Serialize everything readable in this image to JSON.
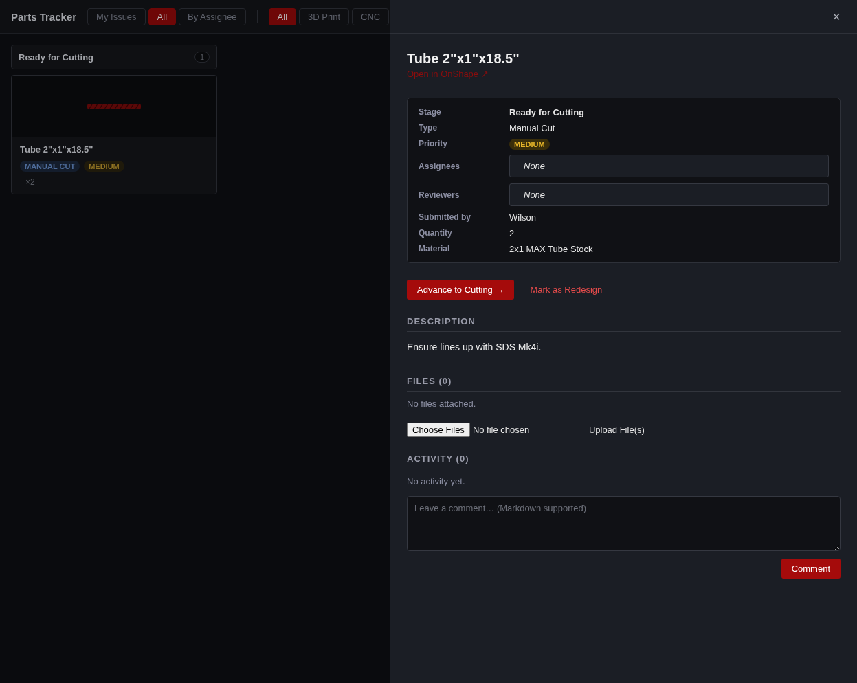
{
  "app": {
    "title": "Parts Tracker"
  },
  "scope_tabs": [
    {
      "label": "My Issues",
      "selected": false
    },
    {
      "label": "All",
      "selected": true
    },
    {
      "label": "By Assignee",
      "selected": false
    }
  ],
  "type_tabs": [
    {
      "label": "All",
      "selected": true
    },
    {
      "label": "3D Print",
      "selected": false
    },
    {
      "label": "CNC",
      "selected": false
    }
  ],
  "column": {
    "title": "Ready for Cutting",
    "count": "1",
    "cards": [
      {
        "title": "Tube 2\"x1\"x18.5\"",
        "tags": [
          {
            "label": "MANUAL CUT",
            "kind": "type"
          },
          {
            "label": "MEDIUM",
            "kind": "priority"
          }
        ],
        "quantity": "×2"
      }
    ]
  },
  "panel": {
    "close": "×",
    "title": "Tube 2\"x1\"x18.5\"",
    "link": "Open in OnShape ↗",
    "fields": [
      {
        "label": "Stage",
        "value": "Ready for Cutting",
        "kind": "strong"
      },
      {
        "label": "Type",
        "value": "Manual Cut",
        "kind": "text"
      },
      {
        "label": "Priority",
        "value": "MEDIUM",
        "kind": "badge"
      },
      {
        "label": "Assignees",
        "value": "None",
        "kind": "picker"
      },
      {
        "label": "Reviewers",
        "value": "None",
        "kind": "picker"
      },
      {
        "label": "Submitted by",
        "value": "Wilson",
        "kind": "text"
      },
      {
        "label": "Quantity",
        "value": "2",
        "kind": "text"
      },
      {
        "label": "Material",
        "value": "2x1 MAX Tube Stock",
        "kind": "text"
      }
    ],
    "primary_action": "Advance to Cutting →",
    "secondary_action": "Mark as Redesign",
    "description": {
      "heading": "DESCRIPTION",
      "text": "Ensure lines up with SDS Mk4i."
    },
    "files": {
      "heading": "FILES (0)",
      "empty": "No files attached.",
      "choose": "Choose Files",
      "chosen": "No file chosen",
      "upload": "Upload File(s)"
    },
    "activity": {
      "heading": "ACTIVITY (0)",
      "empty": "No activity yet.",
      "placeholder": "Leave a comment… (Markdown supported)",
      "submit": "Comment"
    }
  }
}
